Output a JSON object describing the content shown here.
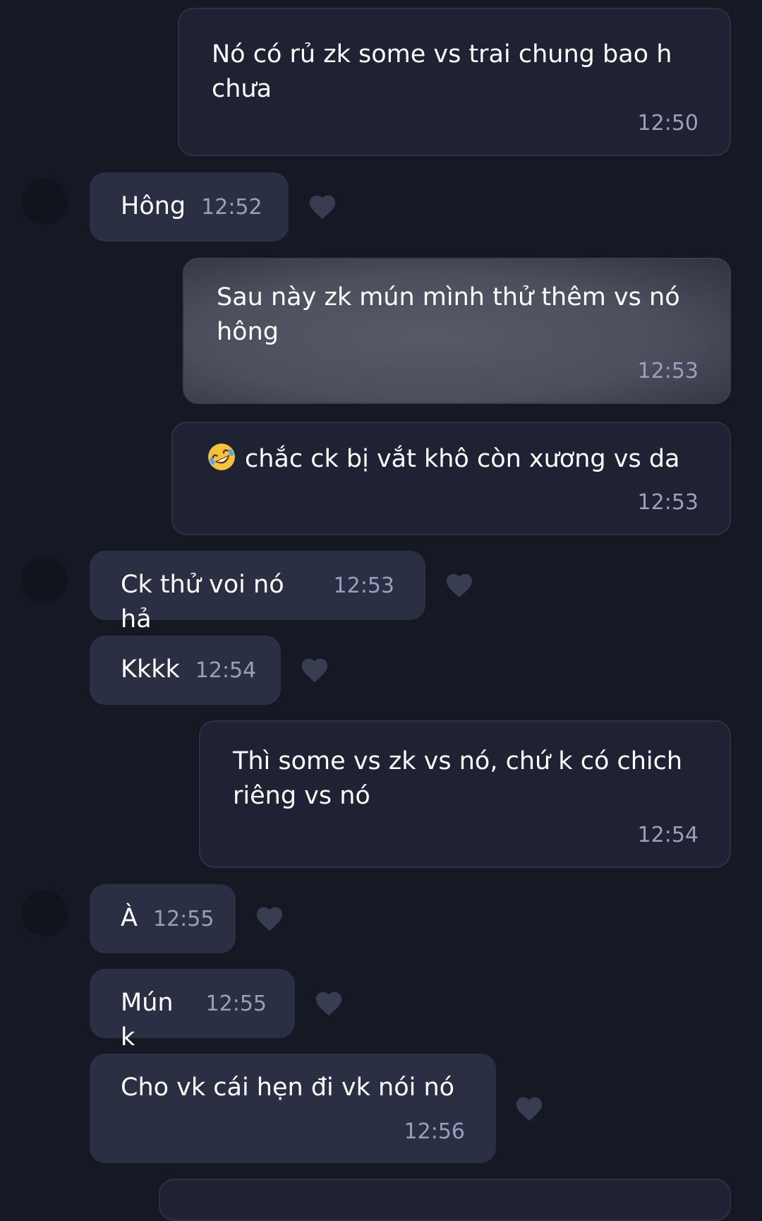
{
  "messages": [
    {
      "text": "Nó có rủ zk some vs trai chung bao h chưa",
      "time": "12:50"
    },
    {
      "text": "Hông",
      "time": "12:52"
    },
    {
      "text": "Sau này zk mún mình thử thêm vs nó hông",
      "time": "12:53"
    },
    {
      "emoji": "rolling-on-the-floor-laughing",
      "text": "chắc ck bị vắt khô còn xương vs da",
      "time": "12:53"
    },
    {
      "text": "Ck thử voi nó hả",
      "time": "12:53"
    },
    {
      "text": "Kkkk",
      "time": "12:54"
    },
    {
      "text": "Thì some vs zk vs nó, chứ k có chich riêng vs nó",
      "time": "12:54"
    },
    {
      "text": "À",
      "time": "12:55"
    },
    {
      "text": "Mún k",
      "time": "12:55"
    },
    {
      "text": "Cho vk cái hẹn đi vk nói nó",
      "time": "12:56"
    }
  ],
  "colors": {
    "background": "#151924",
    "outgoing_bubble": "#1e2232",
    "incoming_bubble": "#2a2f43",
    "timestamp": "#9a9fbd",
    "heart": "#383d52"
  },
  "icons": {
    "reaction": "heart-icon",
    "emoji": "rolling-on-the-floor-laughing"
  }
}
